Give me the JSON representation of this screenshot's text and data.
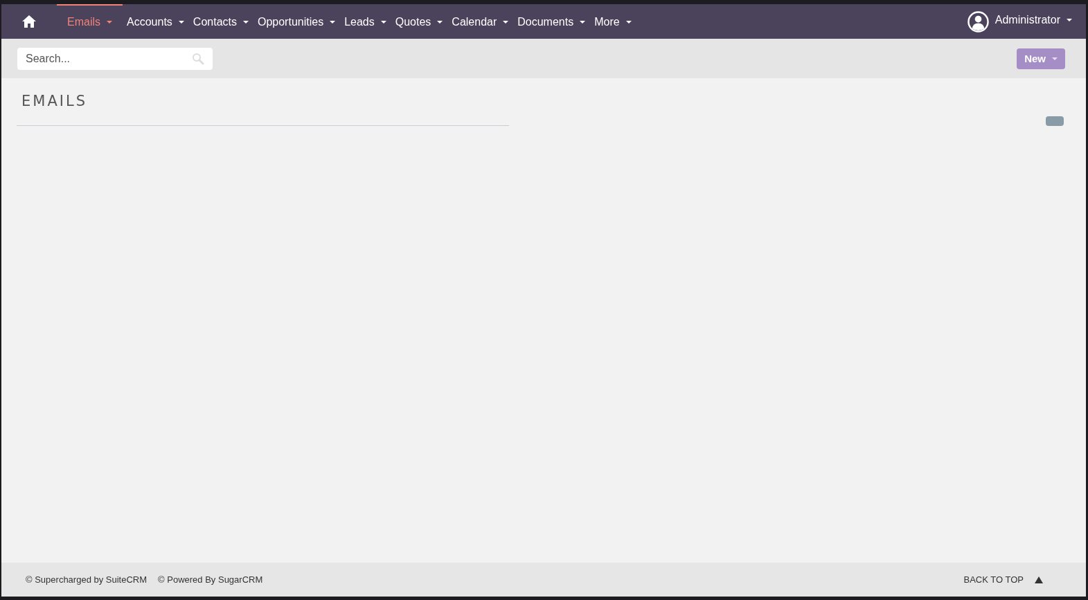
{
  "nav": {
    "items": [
      {
        "label": "Emails",
        "selected": true
      },
      {
        "label": "Accounts",
        "selected": false
      },
      {
        "label": "Contacts",
        "selected": false
      },
      {
        "label": "Opportunities",
        "selected": false
      },
      {
        "label": "Leads",
        "selected": false
      },
      {
        "label": "Quotes",
        "selected": false
      },
      {
        "label": "Calendar",
        "selected": false
      },
      {
        "label": "Documents",
        "selected": false
      },
      {
        "label": "More",
        "selected": false
      }
    ],
    "user": "Administrator"
  },
  "search": {
    "placeholder": "Search..."
  },
  "new_button": "New",
  "page_title": "EMAILS",
  "footer": {
    "links": [
      "© Supercharged by SuiteCRM",
      "© Powered By SugarCRM"
    ],
    "back_to_top": "BACK TO TOP"
  }
}
